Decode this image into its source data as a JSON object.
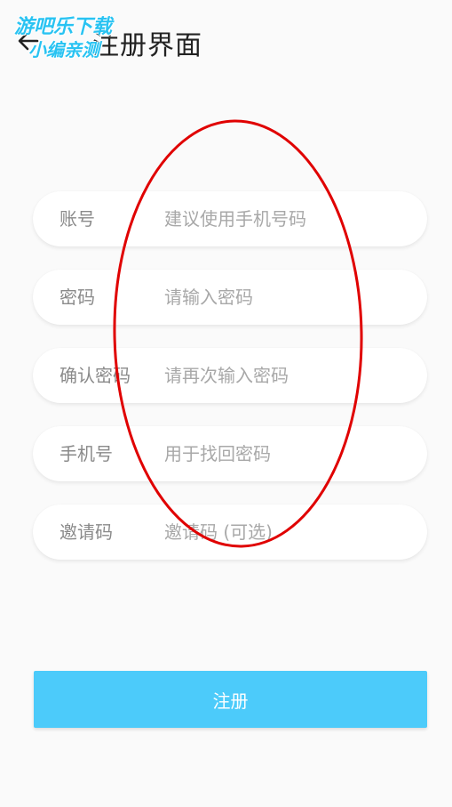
{
  "header": {
    "title": "注册界面"
  },
  "watermark": {
    "line1": "游吧乐下载",
    "line2": "小编亲测"
  },
  "form": {
    "fields": [
      {
        "label": "账号",
        "placeholder": "建议使用手机号码"
      },
      {
        "label": "密码",
        "placeholder": "请输入密码"
      },
      {
        "label": "确认密码",
        "placeholder": "请再次输入密码"
      },
      {
        "label": "手机号",
        "placeholder": "用于找回密码"
      },
      {
        "label": "邀请码",
        "placeholder": "邀请码 (可选)"
      }
    ],
    "submit_label": "注册"
  },
  "colors": {
    "accent": "#4ccbfa",
    "annotation": "#e00000",
    "background": "#fafafa"
  },
  "icons": {
    "back": "arrow-left-icon"
  }
}
